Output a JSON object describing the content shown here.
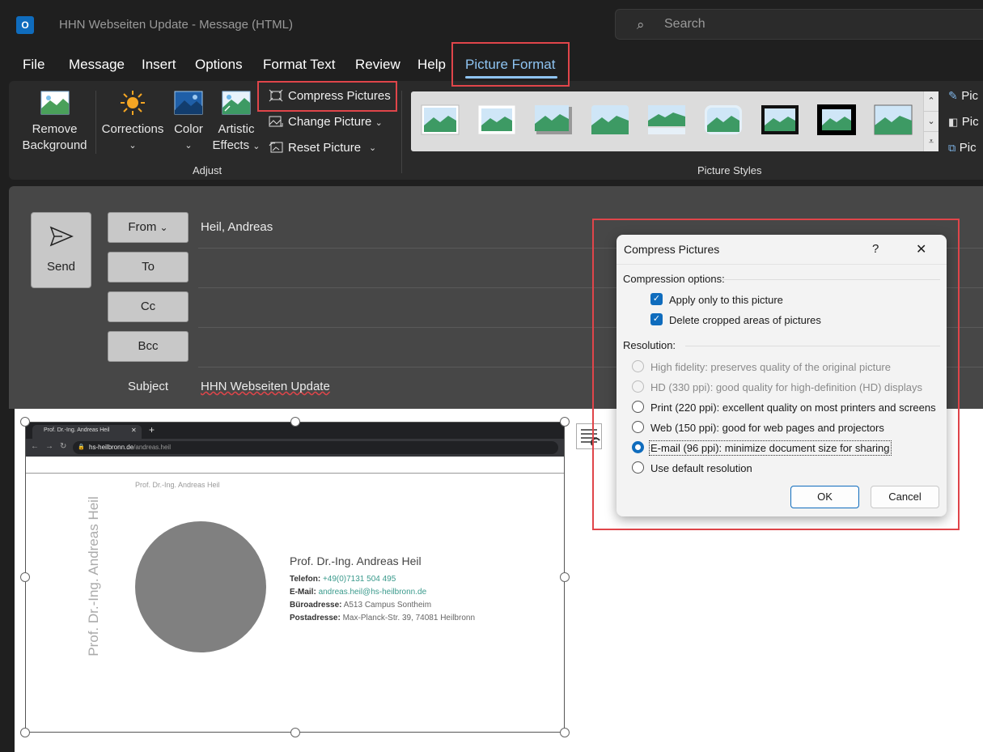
{
  "window": {
    "app_icon": "O",
    "title": "HHN Webseiten Update  -  Message (HTML)",
    "search_placeholder": "Search"
  },
  "menu": {
    "tabs": [
      "File",
      "Message",
      "Insert",
      "Options",
      "Format Text",
      "Review",
      "Help",
      "Picture Format"
    ],
    "active_tab": "Picture Format"
  },
  "ribbon": {
    "remove_background": [
      "Remove",
      "Background"
    ],
    "corrections": "Corrections",
    "color": "Color",
    "artistic_effects": [
      "Artistic",
      "Effects"
    ],
    "compress_pictures": "Compress Pictures",
    "change_picture": "Change Picture",
    "reset_picture": "Reset Picture",
    "adjust_group": "Adjust",
    "picture_styles_group": "Picture Styles",
    "right_items": [
      "Pic",
      "Pic",
      "Pic"
    ]
  },
  "compose": {
    "send": "Send",
    "from_button": "From",
    "from_value": "Heil, Andreas",
    "to_button": "To",
    "cc_button": "Cc",
    "bcc_button": "Bcc",
    "subject_label": "Subject",
    "subject_value": "HHN Webseiten Update"
  },
  "picture": {
    "browser_tab": "Prof. Dr.-Ing. Andreas Heil",
    "url_domain": "hs-heilbronn.de",
    "url_path": "/andreas.heil",
    "page_header": "Prof. Dr.-Ing. Andreas Heil",
    "vertical_name": "Prof. Dr.-Ing. Andreas Heil",
    "name": "Prof. Dr.-Ing. Andreas Heil",
    "phone_label": "Telefon:",
    "phone_value": "+49(0)7131 504 495",
    "email_label": "E-Mail:",
    "email_value": "andreas.heil@hs-heilbronn.de",
    "office_label": "Büroadresse:",
    "office_value": "A513 Campus Sontheim",
    "postal_label": "Postadresse:",
    "postal_value": "Max-Planck-Str. 39, 74081 Heilbronn"
  },
  "dialog": {
    "title": "Compress Pictures",
    "help": "?",
    "close": "✕",
    "compression_heading": "Compression options:",
    "apply_only": "Apply only to this picture",
    "delete_cropped": "Delete cropped areas of pictures",
    "resolution_heading": "Resolution:",
    "options": [
      "High fidelity: preserves quality of the original picture",
      "HD (330 ppi): good quality for high-definition (HD) displays",
      "Print (220 ppi): excellent quality on most printers and screens",
      "Web (150 ppi): good for web pages and projectors",
      "E-mail (96 ppi): minimize document size for sharing",
      "Use default resolution"
    ],
    "selected_option": "E-mail (96 ppi): minimize document size for sharing",
    "ok": "OK",
    "cancel": "Cancel"
  },
  "colors": {
    "accent": "#0f6cbd",
    "highlight": "#e0454a",
    "active_tab": "#8ec4f2",
    "link_teal": "#3a9a8c"
  }
}
